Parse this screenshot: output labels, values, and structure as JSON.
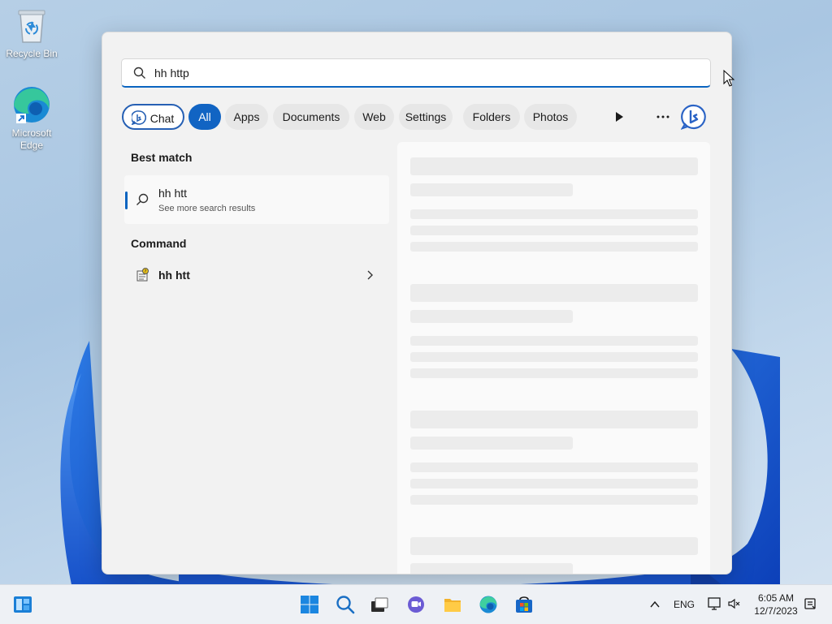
{
  "desktop": {
    "icons": [
      {
        "label": "Recycle Bin",
        "icon": "recycle-bin-icon"
      },
      {
        "label": "Microsoft Edge",
        "icon": "edge-icon"
      }
    ]
  },
  "search": {
    "query": "hh http",
    "filters": [
      {
        "label": "Chat",
        "icon": "bing-chat-icon"
      },
      {
        "label": "All",
        "selected": true
      },
      {
        "label": "Apps"
      },
      {
        "label": "Documents"
      },
      {
        "label": "Web"
      },
      {
        "label": "Settings"
      },
      {
        "label": "Folders"
      },
      {
        "label": "Photos"
      }
    ],
    "controls": [
      "play-icon",
      "more-options-icon",
      "bing-icon"
    ]
  },
  "results": {
    "best_match_heading": "Best match",
    "best_match": {
      "title": "hh htt",
      "subtitle": "See more search results",
      "icon": "search-icon"
    },
    "command_heading": "Command",
    "command": {
      "title": "hh htt",
      "icon": "command-app-icon"
    }
  },
  "preview": {
    "state": "loading"
  },
  "taskbar": {
    "apps": [
      "widgets-icon",
      "start-icon",
      "search-icon",
      "task-view-icon",
      "teams-chat-icon",
      "file-explorer-icon",
      "edge-icon",
      "store-icon"
    ],
    "tray": {
      "language": "ENG",
      "icons": [
        "chevron-up-icon",
        "network-icon",
        "volume-muted-icon",
        "notification-icon"
      ]
    },
    "clock": {
      "time": "6:05 AM",
      "date": "12/7/2023"
    }
  },
  "colors": {
    "accent": "#0a64c0",
    "selected_pill": "#1164c3"
  }
}
